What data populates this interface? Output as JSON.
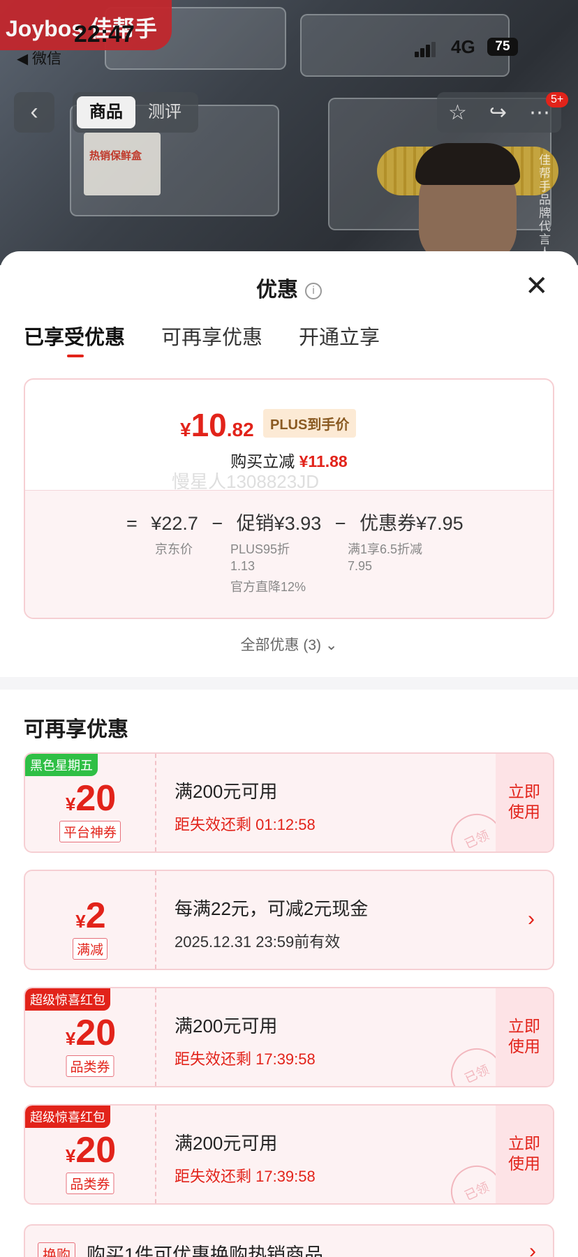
{
  "status_bar": {
    "time": "22:47",
    "network": "4G",
    "battery": "75"
  },
  "backdrop": {
    "brand": "Joybos 佳帮手",
    "back_app": "◀ 微信",
    "side_text": "佳帮手品牌代言人 谢霆锋",
    "box_label": "热销保鲜盒"
  },
  "nav": {
    "tabs": [
      "商品",
      "测评"
    ],
    "badge": "5+"
  },
  "sheet": {
    "title": "优惠",
    "tabs": [
      "已享受优惠",
      "可再享优惠",
      "开通立享"
    ],
    "price": {
      "yen": "¥",
      "int": "10",
      "dec": ".82",
      "tag": "PLUS到手价",
      "reduce_label": "购买立减",
      "reduce_value": "¥11.88"
    },
    "formula": {
      "eq": "=",
      "base": "¥22.7",
      "minus1": "−",
      "promo": "促销¥3.93",
      "minus2": "−",
      "coupon": "优惠券¥7.95",
      "base_label": "京东价",
      "promo_l1": "PLUS95折",
      "promo_l2": "1.13",
      "promo_l3": "官方直降12%",
      "coupon_l1": "满1享6.5折减",
      "coupon_l2": "7.95"
    },
    "watermark": "慢星人1308823JD",
    "all_offers": "全部优惠 (3)",
    "section_title": "可再享优惠"
  },
  "coupons": [
    {
      "tag": "黑色星期五",
      "tag_color": "#2fbf45",
      "yen": "¥",
      "amount": "20",
      "type": "平台神券",
      "main": "满200元可用",
      "sub": "距失效还剩 01:12:58",
      "action": "立即\n使用",
      "stamp": "已领"
    },
    {
      "tag": "",
      "yen": "¥",
      "amount": "2",
      "type": "满减",
      "main": "每满22元，可减2元现金",
      "sub": "2025.12.31 23:59前有效"
    },
    {
      "tag": "超级惊喜红包",
      "tag_color": "#e2231a",
      "yen": "¥",
      "amount": "20",
      "type": "品类券",
      "main": "满200元可用",
      "sub": "距失效还剩 17:39:58",
      "action": "立即\n使用",
      "stamp": "已领"
    },
    {
      "tag": "超级惊喜红包",
      "tag_color": "#e2231a",
      "yen": "¥",
      "amount": "20",
      "type": "品类券",
      "main": "满200元可用",
      "sub": "距失效还剩 17:39:58",
      "action": "立即\n使用",
      "stamp": "已领"
    }
  ],
  "bottom": {
    "tag": "换购",
    "text": "购买1件可优惠换购热销商品"
  }
}
